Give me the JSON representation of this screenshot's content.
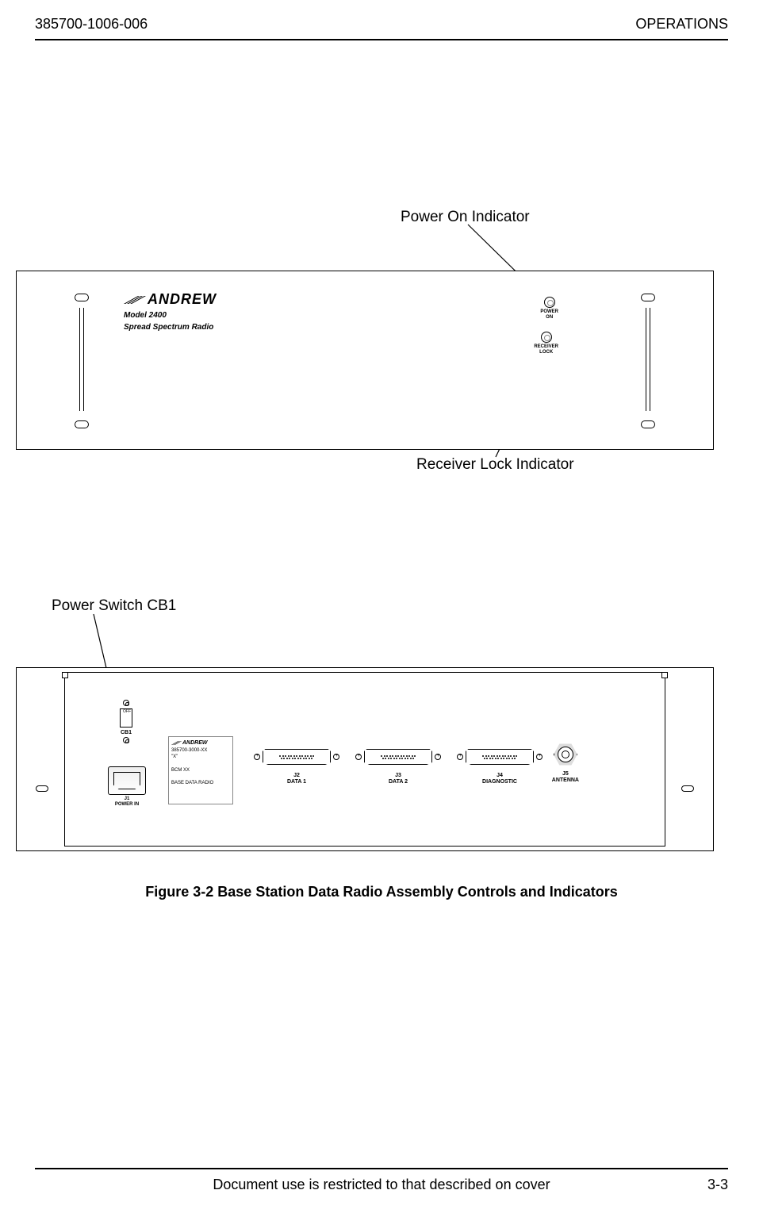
{
  "header": {
    "doc_number": "385700-1006-006",
    "section": "OPERATIONS"
  },
  "callouts": {
    "power_on": "Power On Indicator",
    "receiver_lock": "Receiver Lock Indicator",
    "power_switch": "Power Switch CB1"
  },
  "front_panel": {
    "brand": "ANDREW",
    "model_line1": "Model 2400",
    "model_line2": "Spread Spectrum Radio",
    "led1_line1": "POWER",
    "led1_line2": "ON",
    "led2_line1": "RECEIVER",
    "led2_line2": "LOCK"
  },
  "rear_panel": {
    "cb1_off": "OFF",
    "cb1_label": "CB1",
    "j1_line1": "J1",
    "j1_line2": "POWER IN",
    "info_brand": "ANDREW",
    "info_partno": "385700-3000-XX",
    "info_rev": "\"X\"",
    "info_bcm": "BCM XX",
    "info_desc": "BASE DATA RADIO",
    "j2_line1": "J2",
    "j2_line2": "DATA 1",
    "j3_line1": "J3",
    "j3_line2": "DATA 2",
    "j4_line1": "J4",
    "j4_line2": "DIAGNOSTIC",
    "j5_line1": "J5",
    "j5_line2": "ANTENNA"
  },
  "figure_caption": "Figure 3-2  Base Station Data Radio Assembly Controls and Indicators",
  "footer": {
    "restriction": "Document use is restricted to that described on cover",
    "page": "3-3"
  }
}
